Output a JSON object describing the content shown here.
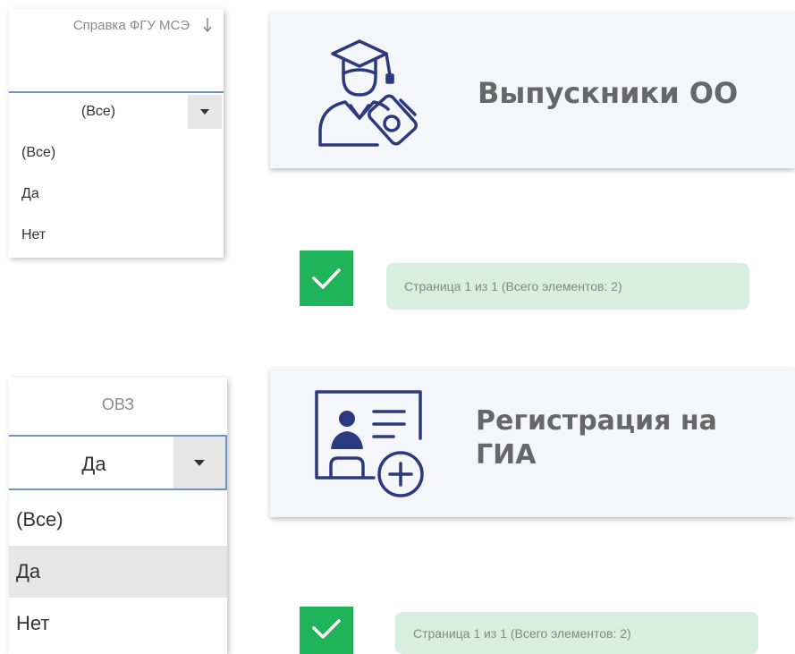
{
  "filter_msz": {
    "header": "Справка ФГУ МСЭ",
    "sort_icon": "sort-arrow-down-icon",
    "selected_value": "(Все)",
    "options": [
      "(Все)",
      "Да",
      "Нет"
    ]
  },
  "filter_ovz": {
    "header": "ОВЗ",
    "selected_value": "Да",
    "options": [
      "(Все)",
      "Да",
      "Нет"
    ]
  },
  "cards": {
    "graduates": {
      "title": "Выпускники ОО",
      "icon": "graduate-icon"
    },
    "gia_registration": {
      "title": "Регистрация на ГИА",
      "icon": "id-card-add-icon"
    }
  },
  "pager_top": {
    "text": "Страница 1 из 1 (Всего элементов: 2)"
  },
  "pager_bottom": {
    "text": "Страница 1 из 1 (Всего элементов: 2)"
  },
  "colors": {
    "accent_green": "#1fb45a",
    "pager_bg": "#d6efde",
    "select_border": "#6b92c9",
    "icon_navy": "#2b3a7e"
  }
}
